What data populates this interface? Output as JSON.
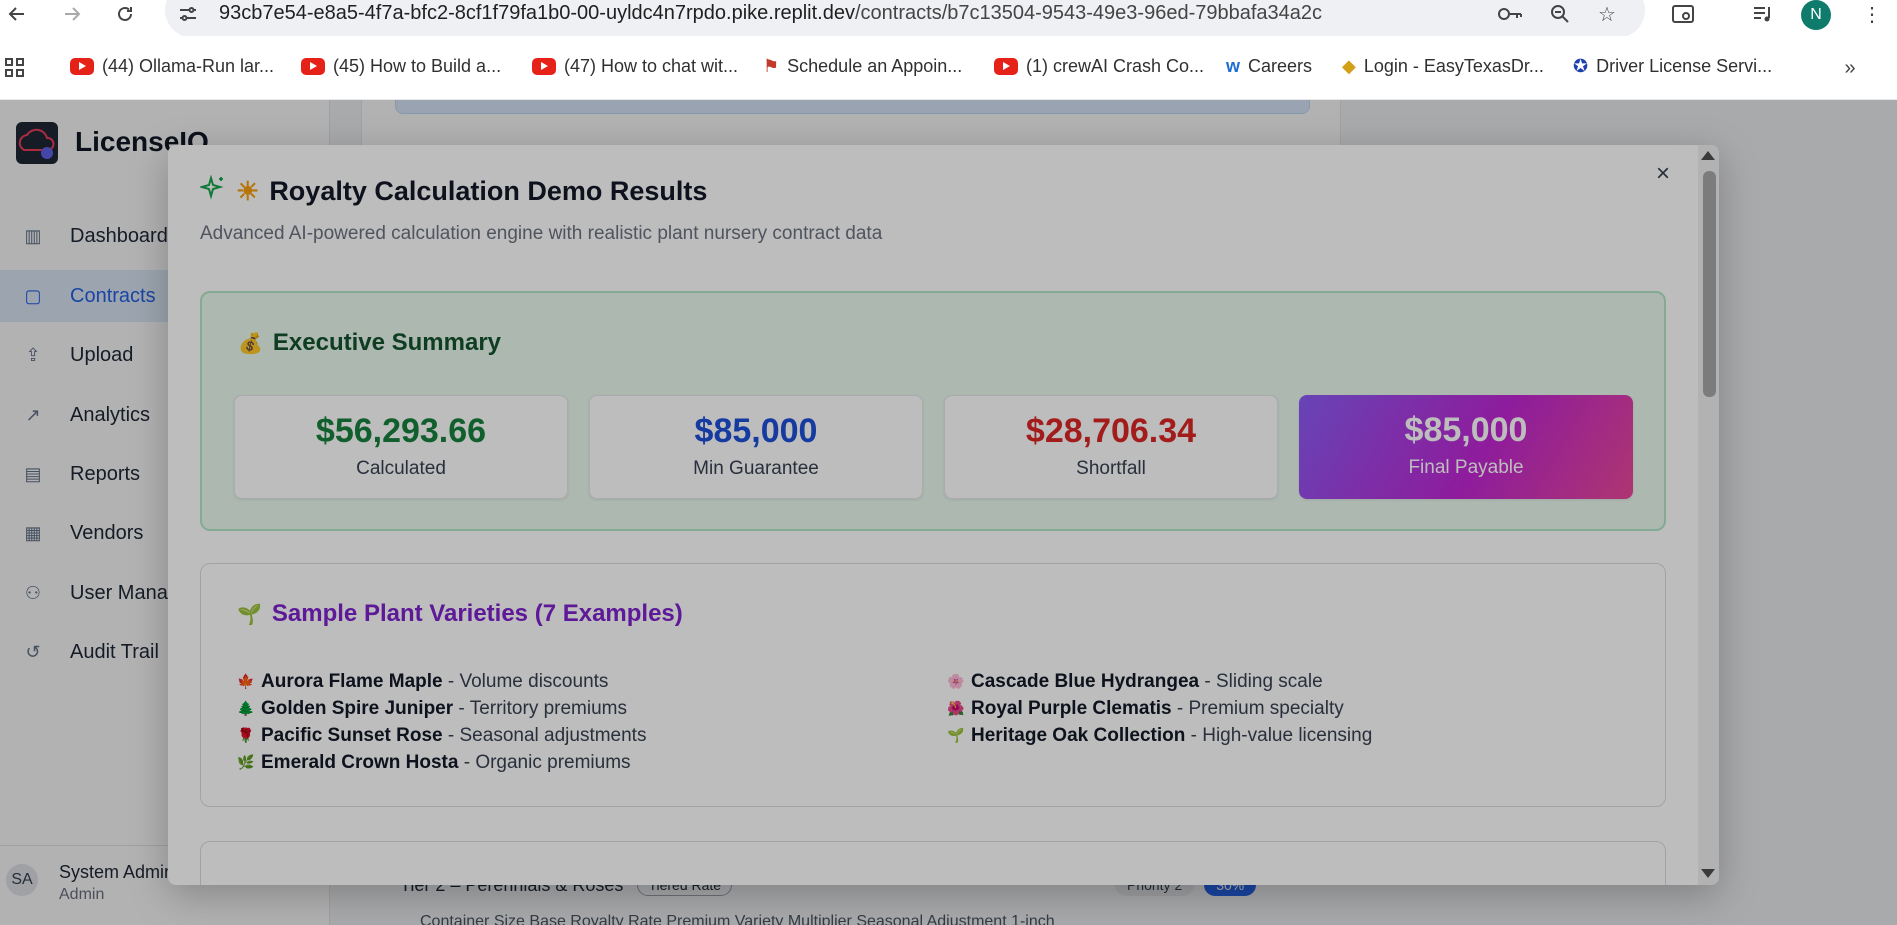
{
  "browser": {
    "url_host": "93cb7e54-e8a5-4f7a-bfc2-8cf1f79fa1b0-00-uyldc4n7rpdo.pike.replit.dev",
    "url_path": "/contracts/b7c13504-9543-49e3-96ed-79bbafa34a2c",
    "profile_initial": "N",
    "bookmarks": [
      {
        "label": "(44) Ollama-Run lar...",
        "icon": "youtube-icon"
      },
      {
        "label": "(45) How to Build a...",
        "icon": "youtube-icon"
      },
      {
        "label": "(47) How to chat wit...",
        "icon": "youtube-icon"
      },
      {
        "label": "Schedule an Appoin...",
        "icon": "flag-icon"
      },
      {
        "label": "(1) crewAI Crash Co...",
        "icon": "youtube-icon"
      },
      {
        "label": "Careers",
        "icon": "workday-icon"
      },
      {
        "label": "Login - EasyTexasDr...",
        "icon": "shield-icon"
      },
      {
        "label": "Driver License Servi...",
        "icon": "seal-icon"
      }
    ]
  },
  "app": {
    "name": "LicenseIQ",
    "sidebar": [
      {
        "label": "Dashboard",
        "icon": "bar-chart-icon"
      },
      {
        "label": "Contracts",
        "icon": "document-icon",
        "active": true
      },
      {
        "label": "Upload",
        "icon": "upload-icon"
      },
      {
        "label": "Analytics",
        "icon": "trending-icon"
      },
      {
        "label": "Reports",
        "icon": "report-icon"
      },
      {
        "label": "Vendors",
        "icon": "building-icon"
      },
      {
        "label": "User Management",
        "icon": "users-icon"
      },
      {
        "label": "Audit Trail",
        "icon": "history-icon"
      }
    ],
    "user": {
      "initials": "SA",
      "name": "System Administrator",
      "role": "Admin"
    },
    "background": {
      "tier_label": "Tier 2 – Perennials & Roses",
      "tier_badge": "Tiered Rate",
      "priority": "Priority 2",
      "percent": "30%",
      "description": "Container Size Base Royalty Rate Premium Variety Multiplier Seasonal Adjustment 1-inch"
    }
  },
  "modal": {
    "title": "Royalty Calculation Demo Results",
    "subtitle": "Advanced AI-powered calculation engine with realistic plant nursery contract data",
    "close_label": "×",
    "executive_summary": {
      "title": "Executive Summary",
      "stats": [
        {
          "value": "$56,293.66",
          "label": "Calculated",
          "color": "#15803d"
        },
        {
          "value": "$85,000",
          "label": "Min Guarantee",
          "color": "#1d4ed8"
        },
        {
          "value": "$28,706.34",
          "label": "Shortfall",
          "color": "#dc2626"
        },
        {
          "value": "$85,000",
          "label": "Final Payable",
          "color": "#ffffff"
        }
      ]
    },
    "plant_varieties": {
      "title": "Sample Plant Varieties (7 Examples)",
      "left": [
        {
          "emoji": "🍁",
          "name": "Aurora Flame Maple",
          "desc": " - Volume discounts"
        },
        {
          "emoji": "🌲",
          "name": "Golden Spire Juniper",
          "desc": " - Territory premiums"
        },
        {
          "emoji": "🌹",
          "name": "Pacific Sunset Rose",
          "desc": " - Seasonal adjustments"
        },
        {
          "emoji": "🌿",
          "name": "Emerald Crown Hosta",
          "desc": " - Organic premiums"
        }
      ],
      "right": [
        {
          "emoji": "🌸",
          "name": "Cascade Blue Hydrangea",
          "desc": " - Sliding scale"
        },
        {
          "emoji": "🌺",
          "name": "Royal Purple Clematis",
          "desc": " - Premium specialty"
        },
        {
          "emoji": "🌱",
          "name": "Heritage Oak Collection",
          "desc": " - High-value licensing"
        }
      ]
    }
  }
}
